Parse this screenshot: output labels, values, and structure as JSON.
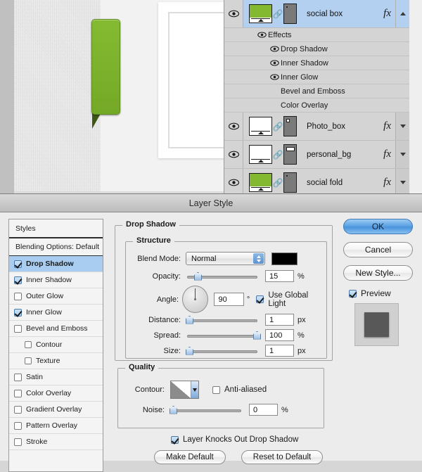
{
  "document": {
    "canvas_name": "photoshop-canvas",
    "green_box_color": "#7cb22c",
    "fold_color": "#3e5717"
  },
  "layers_panel": {
    "rows": [
      {
        "name": "social box",
        "thumb": "green",
        "fx": "fx",
        "chevron": "up",
        "selected": true,
        "visible": true
      },
      {
        "name": "Photo_box",
        "thumb": "white",
        "fx": "fx",
        "chevron": "down",
        "selected": false,
        "visible": true
      },
      {
        "name": "personal_bg",
        "thumb": "white",
        "fx": "fx",
        "chevron": "down",
        "selected": false,
        "visible": true
      },
      {
        "name": "social fold",
        "thumb": "green",
        "fx": "fx",
        "chevron": "down",
        "selected": false,
        "visible": true
      }
    ],
    "effects_group_label": "Effects",
    "effects": [
      {
        "label": "Drop Shadow",
        "visible": true
      },
      {
        "label": "Inner Shadow",
        "visible": true
      },
      {
        "label": "Inner Glow",
        "visible": true
      },
      {
        "label": "Bevel and Emboss",
        "visible": false
      },
      {
        "label": "Color Overlay",
        "visible": false
      }
    ]
  },
  "dialog": {
    "title": "Layer Style",
    "styles_list": {
      "header": "Styles",
      "blending_options": "Blending Options: Default",
      "items": [
        {
          "label": "Drop Shadow",
          "checked": true,
          "active": true,
          "sub": false
        },
        {
          "label": "Inner Shadow",
          "checked": true,
          "active": false,
          "sub": false
        },
        {
          "label": "Outer Glow",
          "checked": false,
          "active": false,
          "sub": false
        },
        {
          "label": "Inner Glow",
          "checked": true,
          "active": false,
          "sub": false
        },
        {
          "label": "Bevel and Emboss",
          "checked": false,
          "active": false,
          "sub": false
        },
        {
          "label": "Contour",
          "checked": false,
          "active": false,
          "sub": true
        },
        {
          "label": "Texture",
          "checked": false,
          "active": false,
          "sub": true
        },
        {
          "label": "Satin",
          "checked": false,
          "active": false,
          "sub": false
        },
        {
          "label": "Color Overlay",
          "checked": false,
          "active": false,
          "sub": false
        },
        {
          "label": "Gradient Overlay",
          "checked": false,
          "active": false,
          "sub": false
        },
        {
          "label": "Pattern Overlay",
          "checked": false,
          "active": false,
          "sub": false
        },
        {
          "label": "Stroke",
          "checked": false,
          "active": false,
          "sub": false
        }
      ]
    },
    "drop_shadow": {
      "group_label": "Drop Shadow",
      "structure": {
        "group_label": "Structure",
        "blend_mode": {
          "label": "Blend Mode:",
          "value": "Normal"
        },
        "shadow_color": "#000000",
        "opacity": {
          "label": "Opacity:",
          "value": "15",
          "unit": "%",
          "percent": 15
        },
        "angle": {
          "label": "Angle:",
          "value": "90",
          "unit": "°",
          "degrees": 90
        },
        "use_global_light": {
          "label": "Use Global Light",
          "checked": true
        },
        "distance": {
          "label": "Distance:",
          "value": "1",
          "unit": "px",
          "percent": 0
        },
        "spread": {
          "label": "Spread:",
          "value": "100",
          "unit": "%",
          "percent": 100
        },
        "size": {
          "label": "Size:",
          "value": "1",
          "unit": "px",
          "percent": 0
        }
      },
      "quality": {
        "group_label": "Quality",
        "contour": {
          "label": "Contour:"
        },
        "anti_aliased": {
          "label": "Anti-aliased",
          "checked": false
        },
        "noise": {
          "label": "Noise:",
          "value": "0",
          "unit": "%",
          "percent": 0
        }
      },
      "layer_knocks_out": {
        "label": "Layer Knocks Out Drop Shadow",
        "checked": true
      },
      "make_default": "Make Default",
      "reset_to_default": "Reset to Default"
    },
    "buttons": {
      "ok": "OK",
      "cancel": "Cancel",
      "new_style": "New Style...",
      "preview": {
        "label": "Preview",
        "checked": true
      }
    }
  }
}
